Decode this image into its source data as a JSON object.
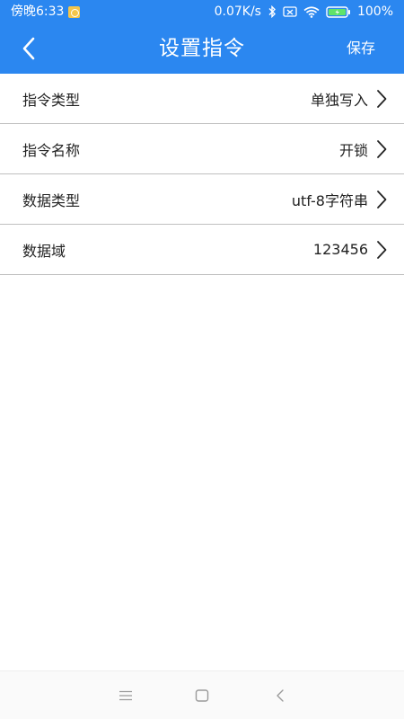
{
  "status_bar": {
    "time": "傍晚6:33",
    "network_speed": "0.07K/s",
    "battery_percent": "100%",
    "icons": [
      "notification-icon",
      "bluetooth-icon",
      "sim-icon",
      "wifi-icon",
      "battery-charging-icon"
    ]
  },
  "header": {
    "title": "设置指令",
    "save_label": "保存",
    "back_icon": "chevron-left-icon"
  },
  "settings": [
    {
      "label": "指令类型",
      "value": "单独写入"
    },
    {
      "label": "指令名称",
      "value": "开锁"
    },
    {
      "label": "数据类型",
      "value": "utf-8字符串"
    },
    {
      "label": "数据域",
      "value": "123456"
    }
  ],
  "nav_bar": {
    "icons": [
      "menu-icon",
      "home-icon",
      "back-icon"
    ]
  },
  "colors": {
    "primary": "#2b87f0",
    "divider": "#bfbfbf",
    "text": "#222222"
  }
}
